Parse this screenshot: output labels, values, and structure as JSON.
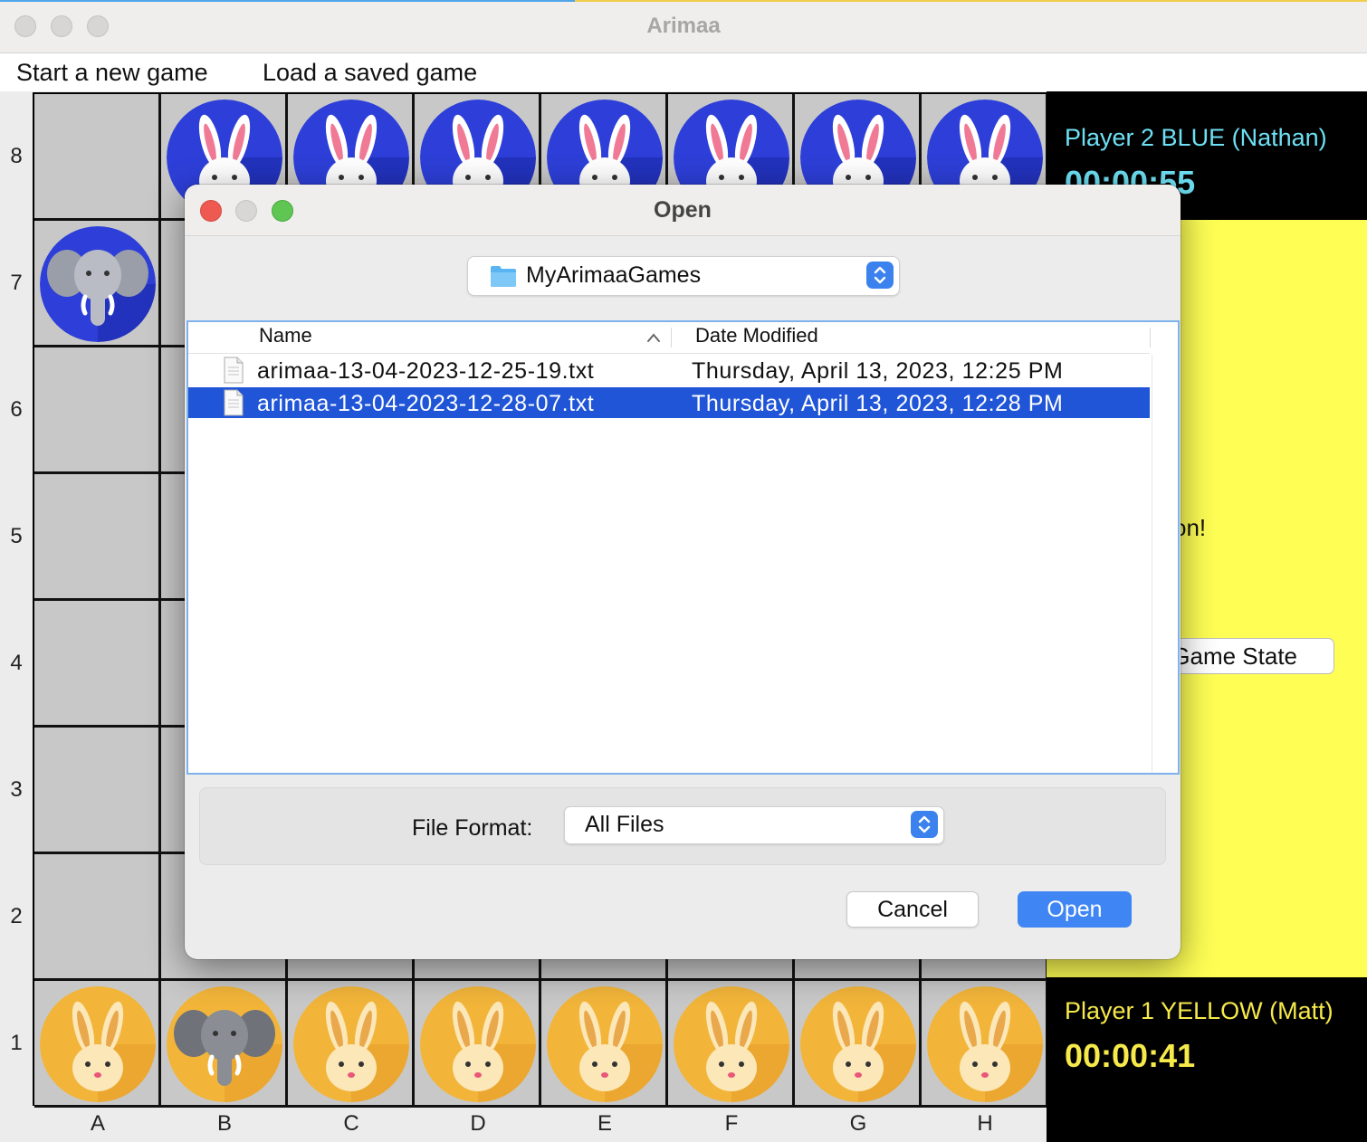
{
  "window": {
    "title": "Arimaa"
  },
  "menu": [
    {
      "label": "Start a new game"
    },
    {
      "label": "Load a saved game"
    }
  ],
  "board": {
    "ranks": [
      "8",
      "7",
      "6",
      "5",
      "4",
      "3",
      "2",
      "1"
    ],
    "files": [
      "A",
      "B",
      "C",
      "D",
      "E",
      "F",
      "G",
      "H"
    ],
    "pieces": [
      {
        "square": "B8",
        "side": "blue",
        "type": "rabbit"
      },
      {
        "square": "C8",
        "side": "blue",
        "type": "rabbit"
      },
      {
        "square": "D8",
        "side": "blue",
        "type": "rabbit"
      },
      {
        "square": "E8",
        "side": "blue",
        "type": "rabbit"
      },
      {
        "square": "F8",
        "side": "blue",
        "type": "rabbit"
      },
      {
        "square": "G8",
        "side": "blue",
        "type": "rabbit"
      },
      {
        "square": "H8",
        "side": "blue",
        "type": "rabbit"
      },
      {
        "square": "A7",
        "side": "blue",
        "type": "elephant"
      },
      {
        "square": "A1",
        "side": "yellow",
        "type": "rabbit"
      },
      {
        "square": "B1",
        "side": "yellow",
        "type": "elephant"
      },
      {
        "square": "C1",
        "side": "yellow",
        "type": "rabbit"
      },
      {
        "square": "D1",
        "side": "yellow",
        "type": "rabbit"
      },
      {
        "square": "E1",
        "side": "yellow",
        "type": "rabbit"
      },
      {
        "square": "F1",
        "side": "yellow",
        "type": "rabbit"
      },
      {
        "square": "G1",
        "side": "yellow",
        "type": "rabbit"
      },
      {
        "square": "H1",
        "side": "yellow",
        "type": "rabbit"
      }
    ]
  },
  "side_panel": {
    "player2": {
      "name": "Player 2 BLUE (Nathan)",
      "time": "00:00:55"
    },
    "status_fragment": "on!",
    "state_button_fragment": "Game State",
    "player1": {
      "name": "Player 1 YELLOW (Matt)",
      "time": "00:00:41"
    }
  },
  "dialog": {
    "title": "Open",
    "folder": {
      "name": "MyArimaaGames",
      "icon": "folder-icon"
    },
    "columns": {
      "name": "Name",
      "date": "Date Modified"
    },
    "files": [
      {
        "name": "arimaa-13-04-2023-12-25-19.txt",
        "date": "Thursday, April 13, 2023, 12:25 PM",
        "selected": false
      },
      {
        "name": "arimaa-13-04-2023-12-28-07.txt",
        "date": "Thursday, April 13, 2023, 12:28 PM",
        "selected": true
      }
    ],
    "format_label": "File Format:",
    "format_value": "All Files",
    "cancel_label": "Cancel",
    "open_label": "Open"
  },
  "colors": {
    "blue_piece": "#2d3fd8",
    "yellow_piece": "#f2b53a",
    "selection": "#1f55d6",
    "accent_button": "#3f86f4",
    "panel_yellow": "#fefe55",
    "player2_text": "#6ee0f4",
    "player1_text": "#f6e94a"
  }
}
